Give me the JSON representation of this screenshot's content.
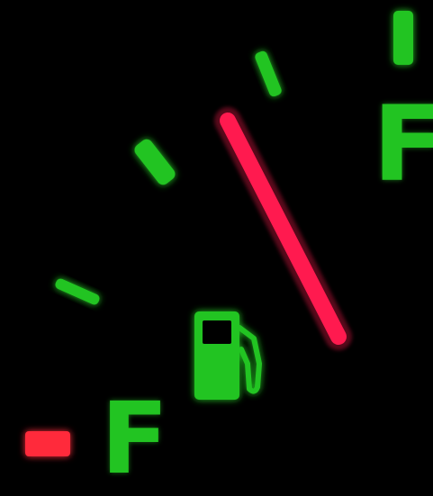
{
  "gauge": {
    "type": "fuel-gauge",
    "icon": "fuel-pump-icon",
    "label_top": "F",
    "label_bottom": "F",
    "needle_level": 0.72,
    "colors": {
      "background": "#000000",
      "markings": "#22c422",
      "needle": "#ff1a4f",
      "low_marker": "#ff2a3a"
    }
  }
}
